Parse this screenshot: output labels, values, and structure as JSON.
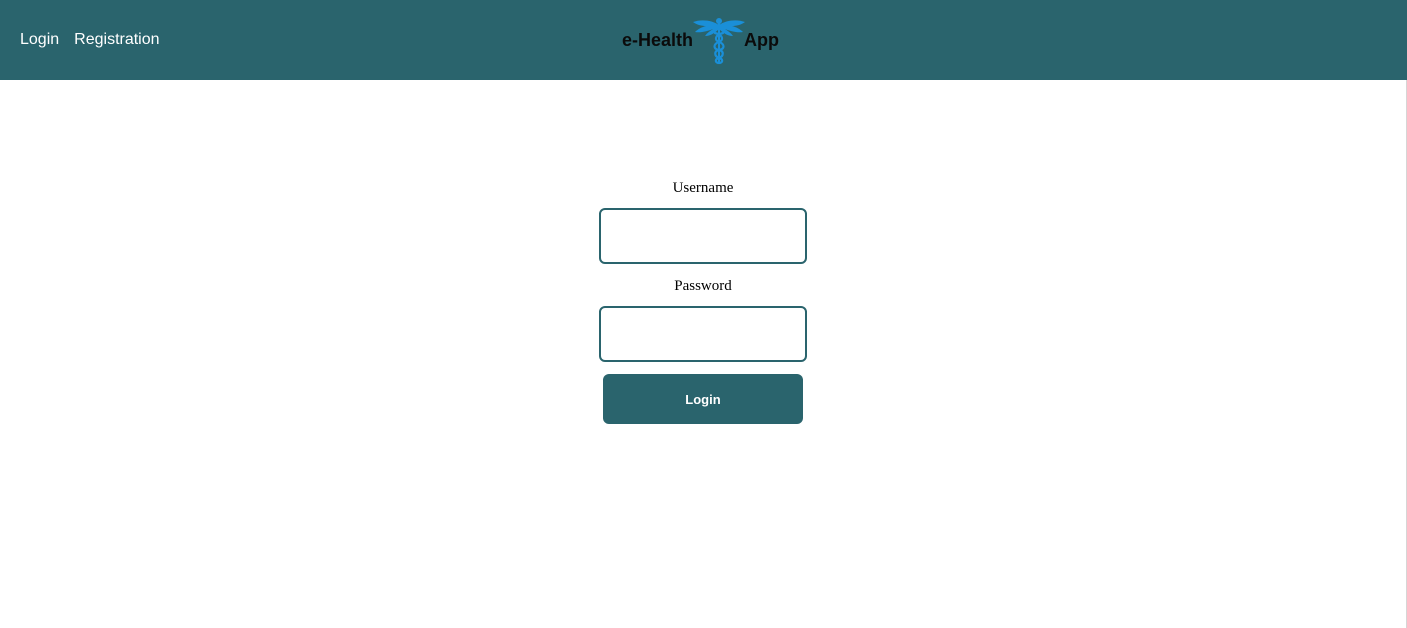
{
  "nav": {
    "links": [
      {
        "label": "Login"
      },
      {
        "label": "Registration"
      }
    ],
    "brand": {
      "left_text": "e-Health",
      "right_text": "App",
      "logo_icon": "caduceus-icon",
      "logo_color": "#1a8fd8"
    }
  },
  "login_form": {
    "username_label": "Username",
    "username_value": "",
    "password_label": "Password",
    "password_value": "",
    "submit_label": "Login"
  },
  "colors": {
    "primary": "#2a646d",
    "nav_text": "#ffffff",
    "background": "#ffffff"
  }
}
